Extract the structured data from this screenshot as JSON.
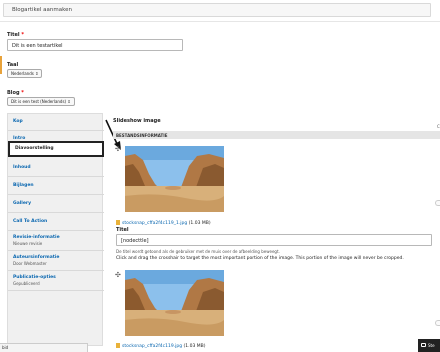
{
  "header": {
    "tab_label": "Blogartikel aanmaken"
  },
  "form": {
    "title_label": "Titel",
    "title_value": "Dit is een testartikel",
    "language_label": "Taal",
    "language_value": "Nederlands",
    "blog_label": "Blog",
    "blog_value": "Dit is een test (Nederlands)",
    "required_mark": "*"
  },
  "sidebar": {
    "items": [
      {
        "label": "Kop",
        "sub": ""
      },
      {
        "label": "Intro",
        "sub": ""
      },
      {
        "label": "Diavoorstelling",
        "sub": ""
      },
      {
        "label": "Inhoud",
        "sub": ""
      },
      {
        "label": "Bijlagen",
        "sub": ""
      },
      {
        "label": "Gallery",
        "sub": ""
      },
      {
        "label": "Call To Action",
        "sub": ""
      },
      {
        "label": "Revisie-informatie",
        "sub": "Nieuwe revisie"
      },
      {
        "label": "Auteursinformatie",
        "sub": "Door Webmaster"
      },
      {
        "label": "Publicatie-opties",
        "sub": "Gepubliceerd"
      }
    ]
  },
  "main": {
    "section_title": "Slideshow image",
    "table_header": "BESTANDSINFORMATIE",
    "right_col_letter": "C",
    "images": [
      {
        "file_name": "stocksnap_cffa2f4c119_1.jpg",
        "file_size": "(1.03 MB)",
        "title_label": "Titel",
        "title_value": "[nodecttle]",
        "title_desc": "De titel wordt getoond als de gebruiker met de muis over de afbeelding beweegt.",
        "instruction": "Click and drag the crosshair to target the most important portion of the image. This portion of the image will never be cropped."
      },
      {
        "file_name": "stocksnap_cffa2f4c119.jpg",
        "file_size": "(1.03 MB)"
      }
    ]
  },
  "statusbar": {
    "text": "bid"
  },
  "chat": {
    "label": "Ste"
  },
  "colors": {
    "link": "#0a67b0",
    "required": "#e00000",
    "accent": "#e8a23a"
  }
}
